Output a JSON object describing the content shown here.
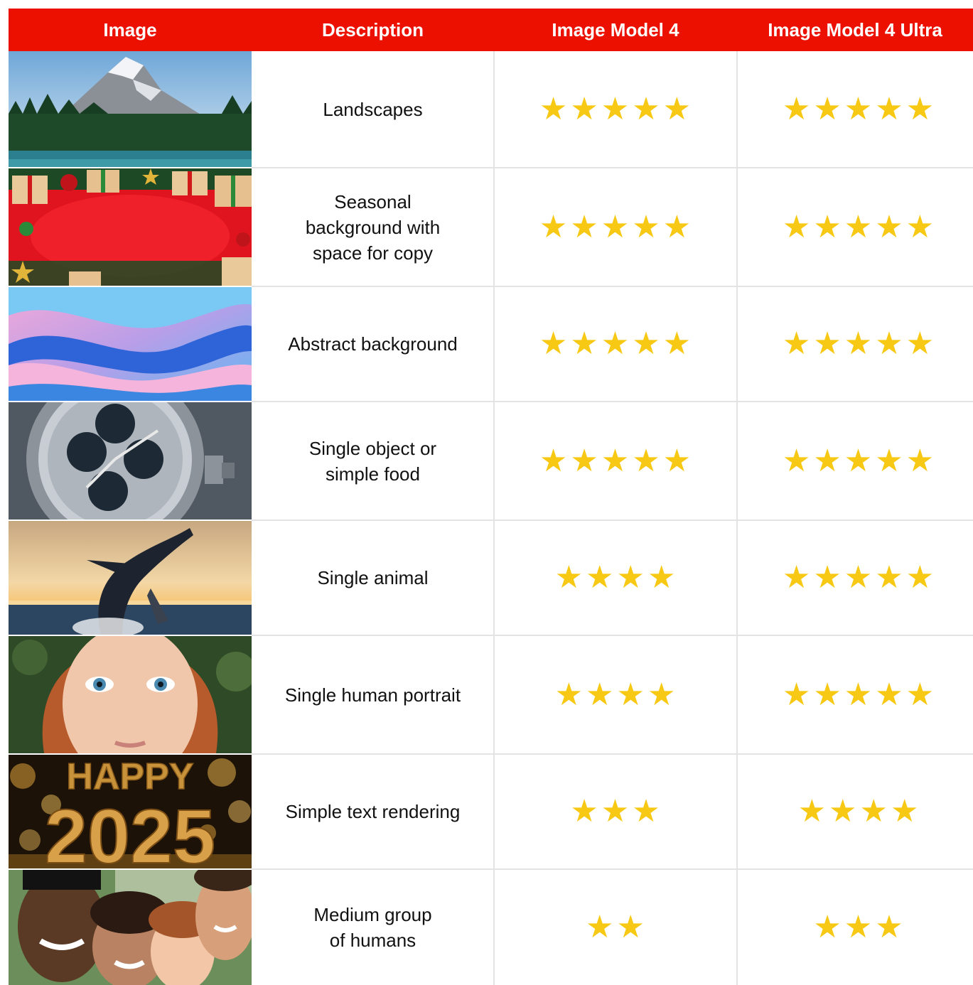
{
  "colors": {
    "header_bg": "#eb1000",
    "star": "#f7c914",
    "grid": "#e3e3e3"
  },
  "header": {
    "image": "Image",
    "description": "Description",
    "model": "Image Model 4",
    "ultra": "Image Model 4 Ultra"
  },
  "rows": [
    {
      "description": "Landscapes",
      "image": "mountain-lake-photo",
      "model_stars": 5,
      "ultra_stars": 5
    },
    {
      "description": "Seasonal\nbackground with\nspace for copy",
      "image": "christmas-gifts-photo",
      "model_stars": 5,
      "ultra_stars": 5
    },
    {
      "description": "Abstract background",
      "image": "abstract-waves-photo",
      "model_stars": 5,
      "ultra_stars": 5
    },
    {
      "description": "Single object or\nsimple food",
      "image": "wristwatch-photo",
      "model_stars": 5,
      "ultra_stars": 5
    },
    {
      "description": "Single animal",
      "image": "humpback-whale-photo",
      "model_stars": 4,
      "ultra_stars": 5
    },
    {
      "description": "Single human portrait",
      "image": "child-portrait-photo",
      "model_stars": 4,
      "ultra_stars": 5
    },
    {
      "description": "Simple text rendering",
      "image": "happy-2025-photo",
      "image_text": [
        "HAPPY",
        "2025"
      ],
      "model_stars": 3,
      "ultra_stars": 4
    },
    {
      "description": "Medium group\nof humans",
      "image": "group-selfie-photo",
      "model_stars": 2,
      "ultra_stars": 3
    }
  ]
}
